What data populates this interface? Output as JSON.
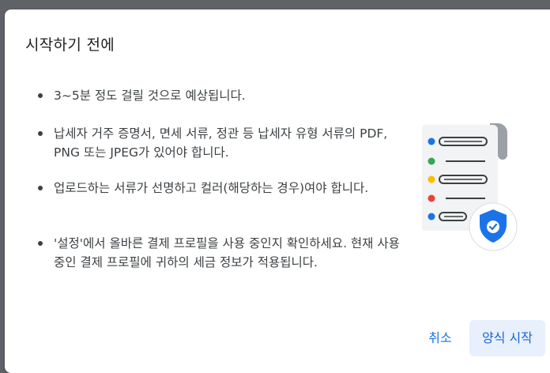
{
  "dialog": {
    "title": "시작하기 전에",
    "items": [
      {
        "text": "3~5분 정도 걸릴 것으로 예상됩니다."
      },
      {
        "text": "납세자 거주 증명서, 면세 서류, 정관 등 납세자 유형 서류의 PDF, PNG 또는 JPEG가 있어야 합니다."
      },
      {
        "text": "업로드하는 서류가 선명하고 컬러(해당하는 경우)여야 합니다."
      },
      {
        "text": "'설정'에서 올바른 결제 프로필을 사용 중인지 확인하세요. 현재 사용 중인 결제 프로필에 귀하의 세금 정보가 적용됩니다."
      }
    ],
    "illustration": {
      "icon": "document-checklist-with-shield-icon",
      "dot_colors": [
        "#1a73e8",
        "#34a853",
        "#fbbc04",
        "#ea4335",
        "#1a73e8"
      ],
      "shield_color": "#1a73e8"
    },
    "actions": {
      "cancel_label": "취소",
      "start_label": "양식 시작"
    }
  }
}
